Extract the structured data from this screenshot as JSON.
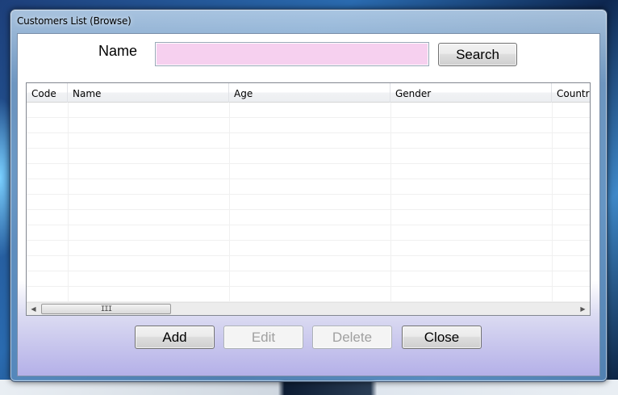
{
  "window": {
    "title": "Customers List (Browse)"
  },
  "search": {
    "label": "Name",
    "value": "",
    "placeholder": "",
    "button_label": "Search"
  },
  "grid": {
    "columns": [
      "Code",
      "Name",
      "Age",
      "Gender",
      "Country"
    ],
    "rows": [],
    "scroll_thumb_glyph": "III"
  },
  "actions": {
    "add_label": "Add",
    "edit_label": "Edit",
    "delete_label": "Delete",
    "close_label": "Close"
  },
  "colors": {
    "search_field_bg": "#f6d0ef",
    "disabled_text": "#a0a0a0"
  }
}
